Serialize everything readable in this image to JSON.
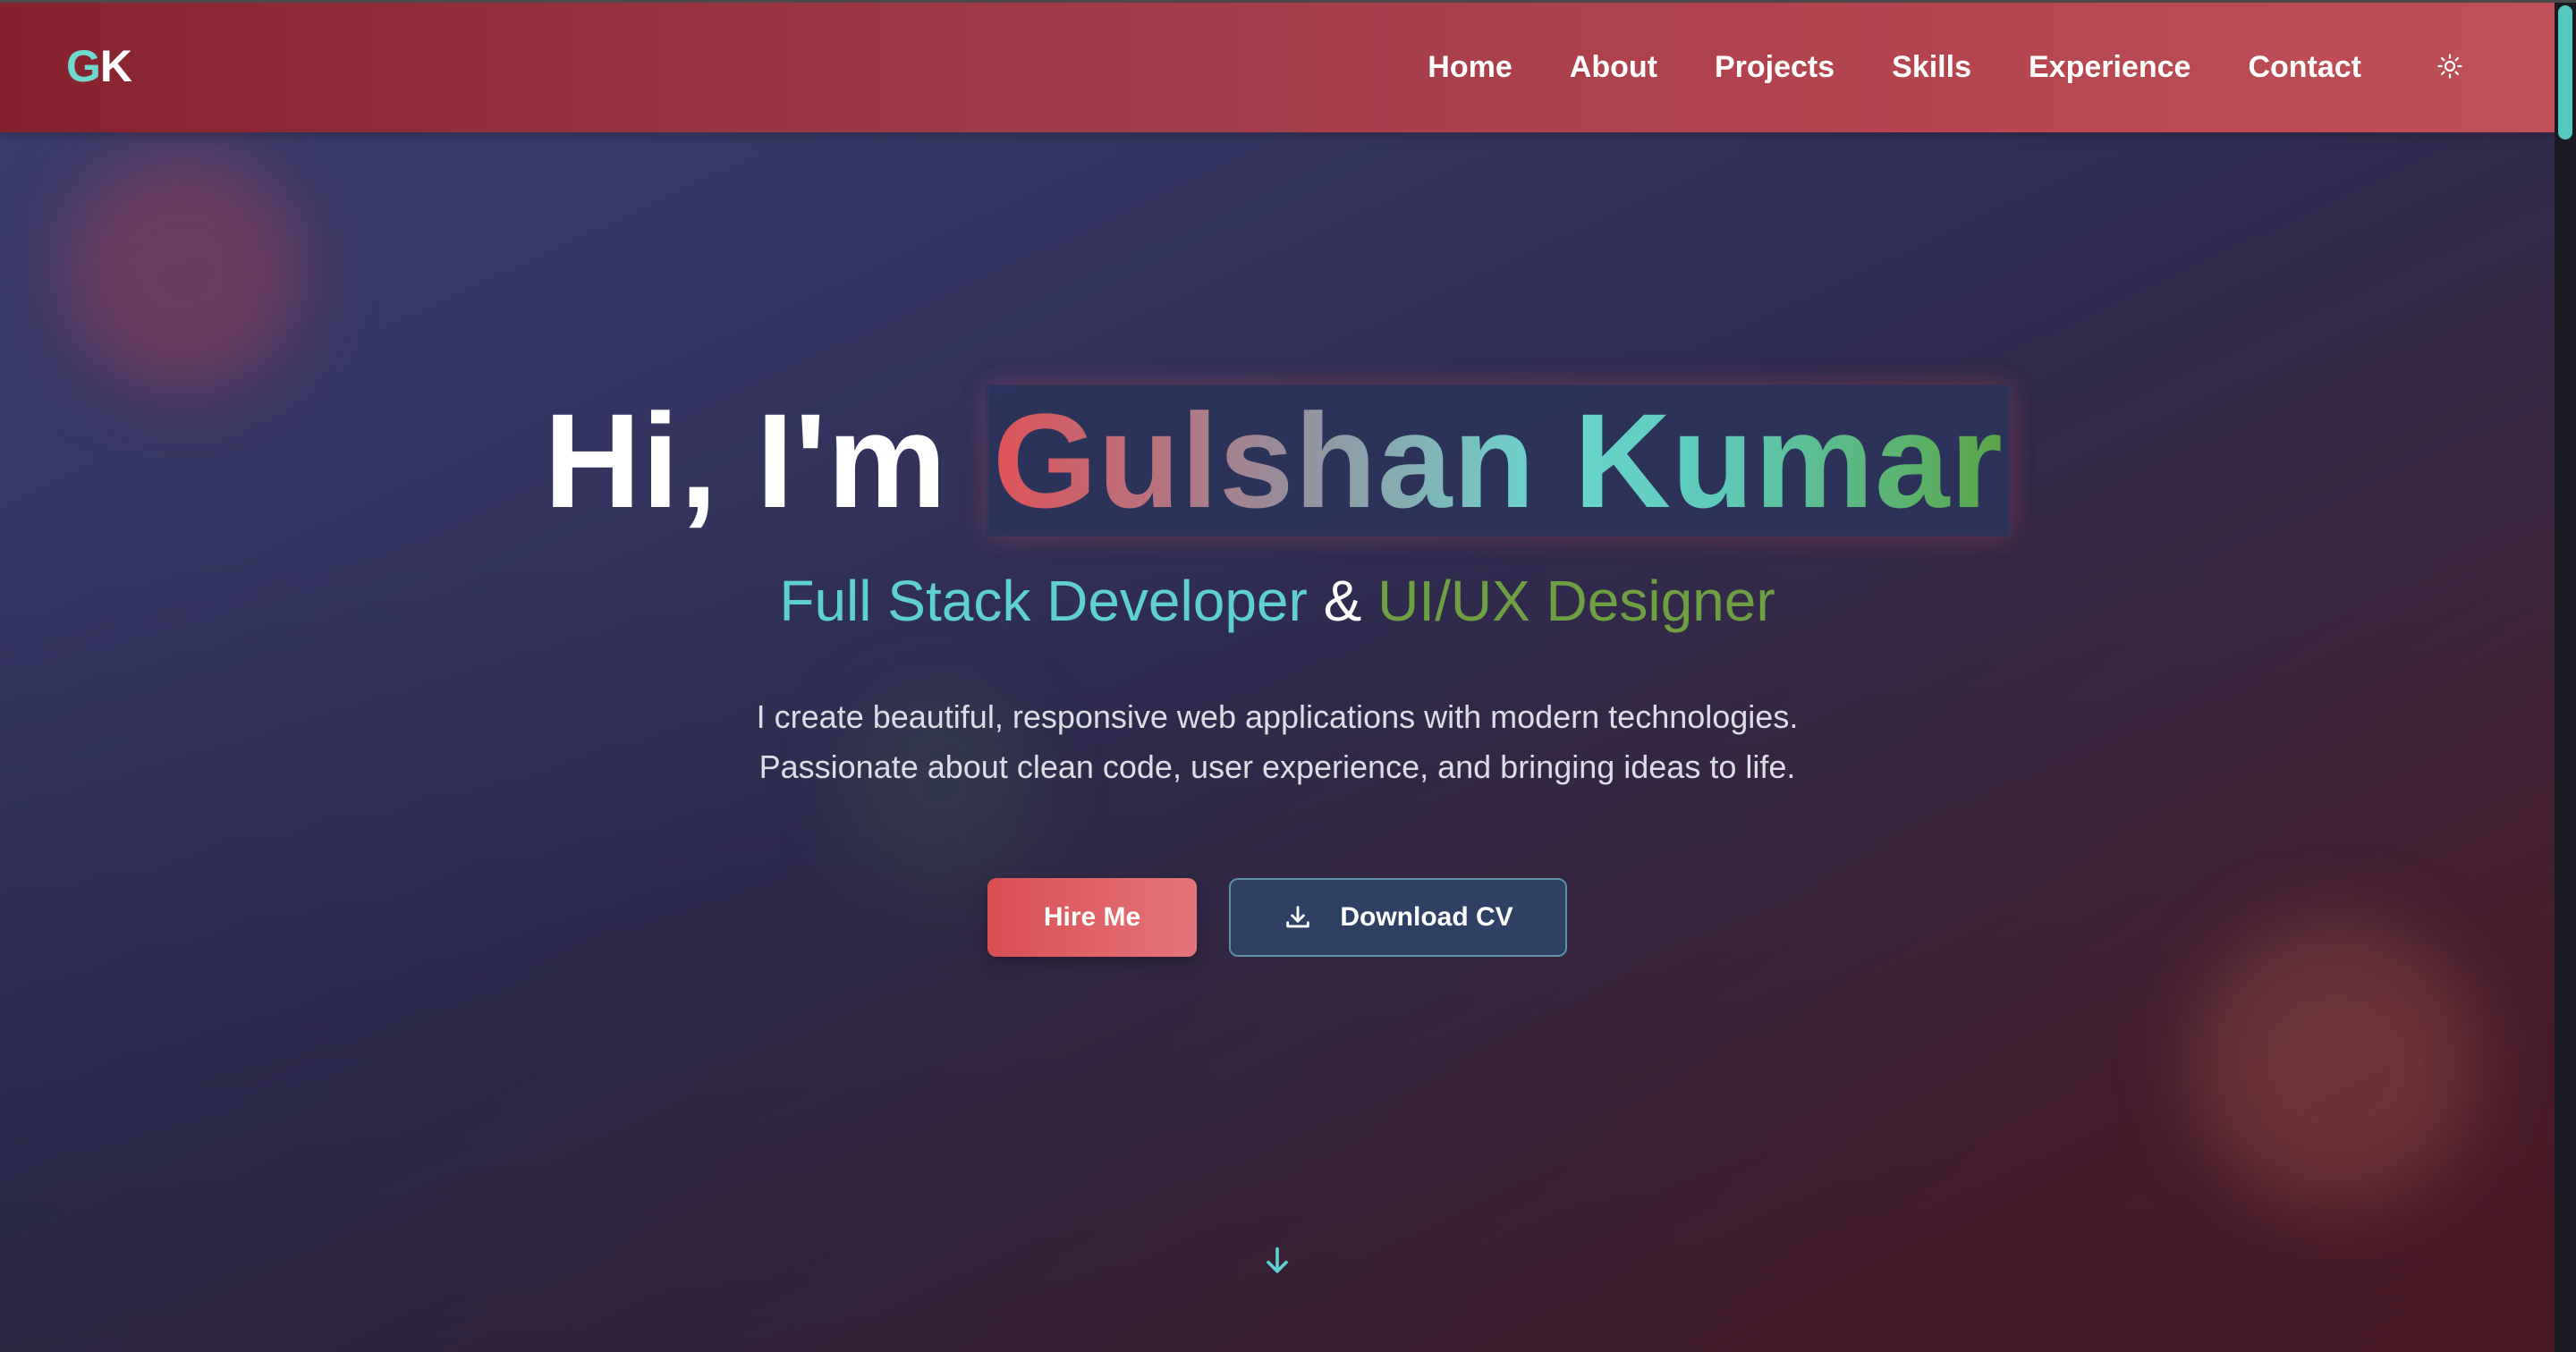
{
  "header": {
    "logo_g": "G",
    "logo_k": "K",
    "nav_items": [
      {
        "label": "Home"
      },
      {
        "label": "About"
      },
      {
        "label": "Projects"
      },
      {
        "label": "Skills"
      },
      {
        "label": "Experience"
      },
      {
        "label": "Contact"
      }
    ],
    "theme_toggle_icon": "sun-icon"
  },
  "hero": {
    "greeting": "Hi, I'm ",
    "name": "Gulshan Kumar",
    "subtitle_part1": "Full Stack Developer",
    "subtitle_amp": " & ",
    "subtitle_part2": "UI/UX Designer",
    "description_line1": "I create beautiful, responsive web applications with modern technologies.",
    "description_line2": "Passionate about clean code, user experience, and bringing ideas to life.",
    "hire_label": "Hire Me",
    "download_label": "Download CV",
    "download_icon": "download-icon",
    "scroll_icon": "arrow-down-icon"
  },
  "colors": {
    "accent_teal": "#6fd9cf",
    "accent_red": "#d94f52",
    "accent_green": "#6ea042",
    "navbar_start": "#86222e",
    "navbar_end": "#c05058"
  }
}
